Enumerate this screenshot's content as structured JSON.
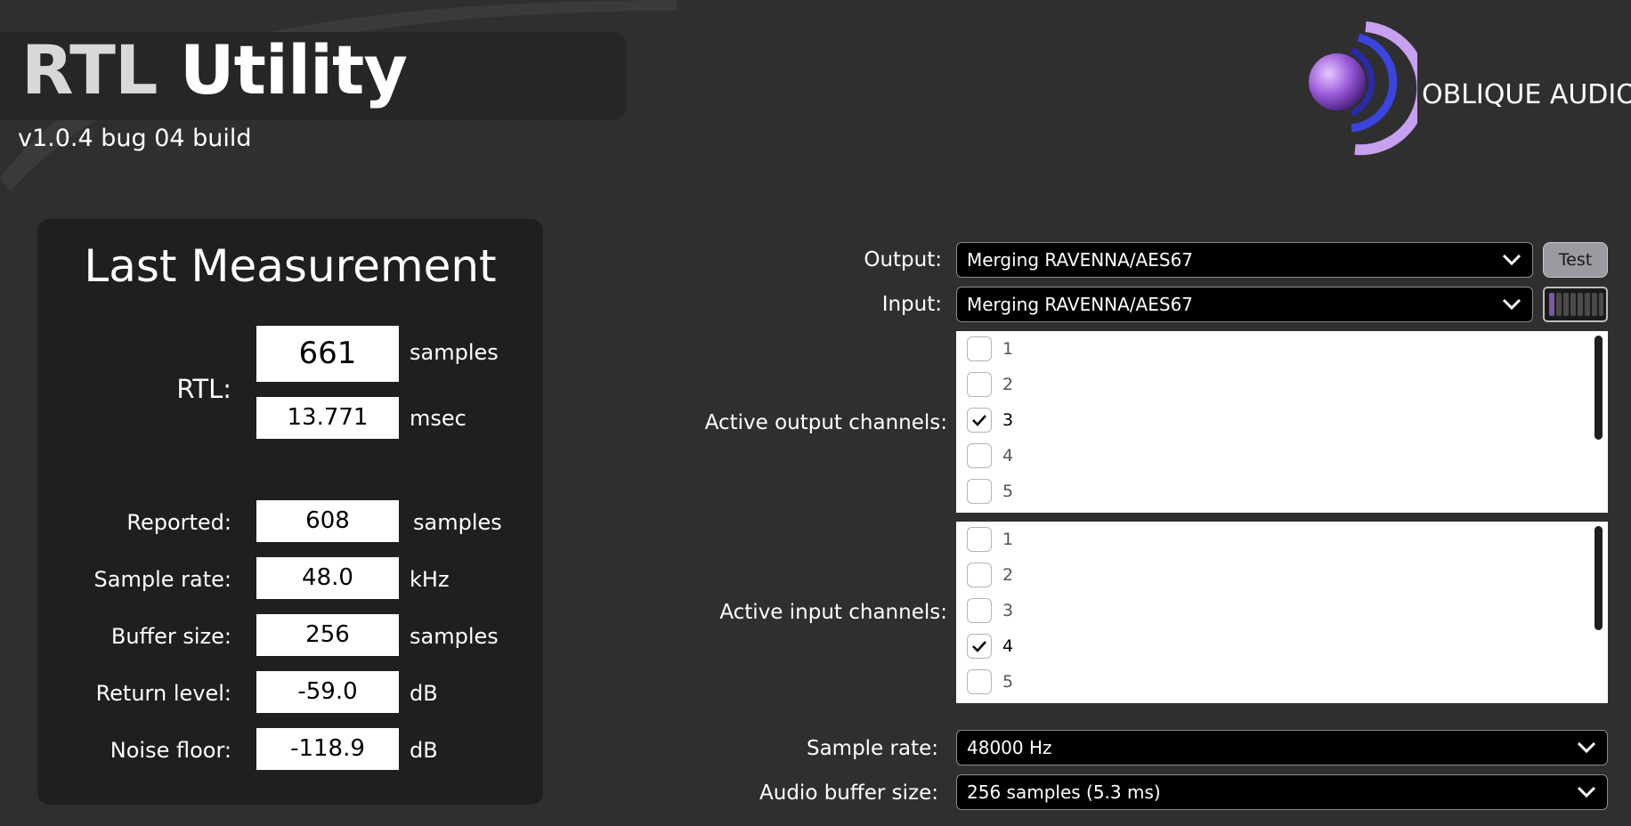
{
  "header": {
    "title_part1": "RTL",
    "title_part2": "Utility",
    "version": "v1.0.4 bug 04 build",
    "brand": "OBLIQUE AUDIO",
    "logo_icon": "oblique-audio-logo-icon"
  },
  "measurement": {
    "title": "Last Measurement",
    "rtl_label": "RTL:",
    "rtl_samples": "661",
    "rtl_samples_unit": "samples",
    "rtl_msec": "13.771",
    "rtl_msec_unit": "msec",
    "rows": [
      {
        "label": "Reported:",
        "value": "608",
        "unit": "samples"
      },
      {
        "label": "Sample rate:",
        "value": "48.0",
        "unit": "kHz"
      },
      {
        "label": "Buffer size:",
        "value": "256",
        "unit": "samples"
      },
      {
        "label": "Return level:",
        "value": "-59.0",
        "unit": "dB"
      },
      {
        "label": "Noise floor:",
        "value": "-118.9",
        "unit": "dB"
      }
    ]
  },
  "settings": {
    "output_label": "Output:",
    "output_value": "Merging RAVENNA/AES67",
    "test_button": "Test",
    "input_label": "Input:",
    "input_value": "Merging RAVENNA/AES67",
    "output_channels_label": "Active output channels:",
    "output_channels": [
      {
        "num": "1",
        "checked": false
      },
      {
        "num": "2",
        "checked": false
      },
      {
        "num": "3",
        "checked": true
      },
      {
        "num": "4",
        "checked": false
      },
      {
        "num": "5",
        "checked": false
      }
    ],
    "input_channels_label": "Active input channels:",
    "input_channels": [
      {
        "num": "1",
        "checked": false
      },
      {
        "num": "2",
        "checked": false
      },
      {
        "num": "3",
        "checked": false
      },
      {
        "num": "4",
        "checked": true
      },
      {
        "num": "5",
        "checked": false
      }
    ],
    "sample_rate_label": "Sample rate:",
    "sample_rate_value": "48000 Hz",
    "buffer_label": "Audio buffer size:",
    "buffer_value": "256 samples (5.3 ms)"
  },
  "colors": {
    "background": "#2f2f2f",
    "panel": "#1f1f1f",
    "accent_purple": "#b48ce6",
    "accent_blue": "#3a3ad2"
  }
}
